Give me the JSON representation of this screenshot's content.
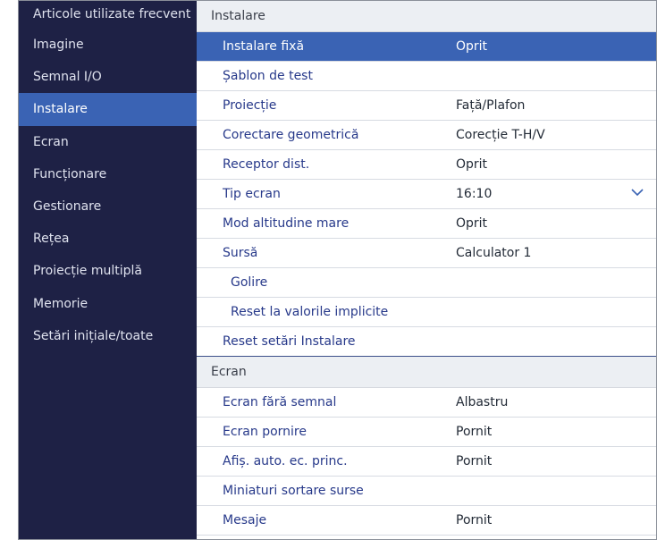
{
  "sidebar": {
    "items": [
      {
        "label": "Articole utilizate frecvent"
      },
      {
        "label": "Imagine"
      },
      {
        "label": "Semnal I/O"
      },
      {
        "label": "Instalare"
      },
      {
        "label": "Ecran"
      },
      {
        "label": "Funcționare"
      },
      {
        "label": "Gestionare"
      },
      {
        "label": "Rețea"
      },
      {
        "label": "Proiecție multiplă"
      },
      {
        "label": "Memorie"
      },
      {
        "label": "Setări inițiale/toate"
      }
    ],
    "active_index": 3
  },
  "sections": [
    {
      "title": "Instalare",
      "rows": [
        {
          "label": "Instalare fixă",
          "value": "Oprit"
        },
        {
          "label": "Șablon de test",
          "value": ""
        },
        {
          "label": "Proiecție",
          "value": "Față/Plafon"
        },
        {
          "label": "Corectare geometrică",
          "value": "Corecție T-H/V"
        },
        {
          "label": "Receptor dist.",
          "value": "Oprit"
        },
        {
          "label": "Tip ecran",
          "value": "16:10"
        },
        {
          "label": "Mod altitudine mare",
          "value": "Oprit"
        },
        {
          "label": "Sursă",
          "value": "Calculator 1"
        },
        {
          "label": "Golire",
          "value": ""
        },
        {
          "label": "Reset la valorile implicite",
          "value": ""
        },
        {
          "label": "Reset setări Instalare",
          "value": ""
        }
      ]
    },
    {
      "title": "Ecran",
      "rows": [
        {
          "label": "Ecran fără semnal",
          "value": "Albastru"
        },
        {
          "label": "Ecran pornire",
          "value": "Pornit"
        },
        {
          "label": "Afiș. auto. ec. princ.",
          "value": "Pornit"
        },
        {
          "label": "Miniaturi sortare surse",
          "value": ""
        },
        {
          "label": "Mesaje",
          "value": "Pornit"
        }
      ]
    }
  ],
  "selected_row": "Instalare fixă",
  "icons": {
    "dropdown": "chevron-down-icon"
  },
  "colors": {
    "sidebar_bg": "#1e2145",
    "highlight": "#3a63b4",
    "label_text": "#27398a",
    "section_header_bg": "#eceff3"
  }
}
